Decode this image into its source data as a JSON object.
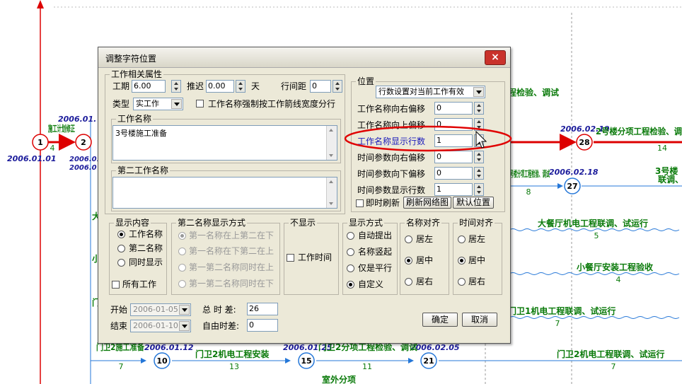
{
  "background": {
    "nodes": [
      "1",
      "2",
      "28",
      "27",
      "10",
      "15",
      "21"
    ],
    "dates": [
      "2006.01.01",
      "2006.01.",
      "2006.02.19",
      "2006.02.18",
      "2006.01.12",
      "2006.01.25",
      "2006.02.05",
      "2006.01",
      "2006.0"
    ],
    "tasks": [
      {
        "name": "施工计划修正",
        "dur": "4"
      },
      {
        "name": "程检验、调试",
        "dur": ""
      },
      {
        "name": "2号楼分项工程检验、调",
        "dur": "14"
      },
      {
        "name": "1号楼分项工程检验、调试",
        "dur": "8"
      },
      {
        "name": "3号楼",
        "dur": ""
      },
      {
        "name": "联调、",
        "dur": ""
      },
      {
        "name": "大餐厅机电工程联调、试运行",
        "dur": "5"
      },
      {
        "name": "小餐厅安装工程验收",
        "dur": "4"
      },
      {
        "name": "门卫1机电工程联调、试运行",
        "dur": "7"
      },
      {
        "name": "门卫2施工准备",
        "dur": "7"
      },
      {
        "name": "门卫2机电工程安装",
        "dur": "13"
      },
      {
        "name": "门卫2分项工程检验、调试",
        "dur": "11"
      },
      {
        "name": "门卫2机电工程联调、试运行",
        "dur": "7"
      },
      {
        "name": "室外分项",
        "dur": ""
      },
      {
        "name": "大",
        "dur": ""
      },
      {
        "name": "小",
        "dur": ""
      },
      {
        "name": "门",
        "dur": ""
      }
    ]
  },
  "dialog": {
    "title": "调整字符位置",
    "close_label": "×",
    "work_props": {
      "label": "工作相关属性",
      "duration_label": "工期",
      "duration_value": "6.00",
      "delay_label": "推迟",
      "delay_value": "0.00",
      "day_unit": "天",
      "line_spacing_label": "行间距",
      "line_spacing_value": "0",
      "type_label": "类型",
      "type_value": "实工作",
      "force_width_label": "工作名称强制按工作箭线宽度分行"
    },
    "work_name": {
      "label": "工作名称",
      "value": "3号楼施工准备"
    },
    "second_name": {
      "label": "第二工作名称",
      "value": ""
    },
    "position": {
      "label": "位置",
      "mode_value": "行数设置对当前工作有效",
      "rows": [
        {
          "label": "工作名称向右偏移",
          "value": "0"
        },
        {
          "label": "工作名称向上偏移",
          "value": "0"
        },
        {
          "label": "工作名称显示行数",
          "value": "1"
        },
        {
          "label": "时间参数向右偏移",
          "value": "0"
        },
        {
          "label": "时间参数向下偏移",
          "value": "0"
        },
        {
          "label": "时间参数显示行数",
          "value": "1"
        }
      ],
      "realtime_label": "即时刷新",
      "refresh_label": "刷新网络图",
      "default_label": "默认位置"
    },
    "display_content": {
      "label": "显示内容",
      "options": [
        "工作名称",
        "第二名称",
        "同时显示"
      ],
      "selected": 0,
      "all_works_label": "所有工作"
    },
    "second_name_mode": {
      "label": "第二名称显示方式",
      "options": [
        "第一名称在上第二在下",
        "第一名称在下第二在上",
        "第一第二名称同时在上",
        "第一第二名称同时在下"
      ],
      "selected": 0
    },
    "hide": {
      "label": "不显示",
      "work_time_label": "工作时间"
    },
    "display_mode": {
      "label": "显示方式",
      "options": [
        "自动提出",
        "名称竖起",
        "仅是平行",
        "自定义"
      ],
      "selected": 3
    },
    "name_align": {
      "label": "名称对齐",
      "options": [
        "居左",
        "居中",
        "居右"
      ],
      "selected": 1
    },
    "time_align": {
      "label": "时间对齐",
      "options": [
        "居左",
        "居中",
        "居右"
      ],
      "selected": 1
    },
    "start_label": "开始",
    "start_value": "2006-01-05",
    "end_label": "结束",
    "end_value": "2006-01-10",
    "total_float_label": "总 时 差:",
    "total_float_value": "26",
    "free_float_label": "自由时差:",
    "free_float_value": "0",
    "ok_label": "确定",
    "cancel_label": "取消"
  }
}
